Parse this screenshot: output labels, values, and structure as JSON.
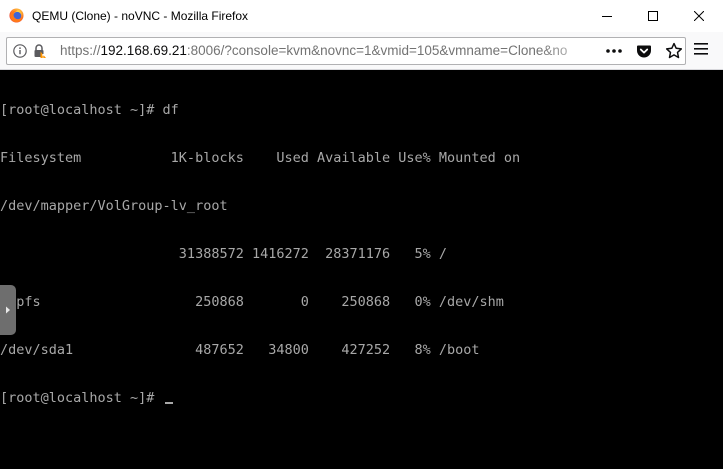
{
  "window": {
    "title": "QEMU (Clone) - noVNC - Mozilla Firefox",
    "controls": [
      "minimize-icon",
      "maximize-icon",
      "close-icon"
    ]
  },
  "navbar": {
    "url_scheme": "https://",
    "url_host": "192.168.69.21",
    "url_rest": ":8006/?console=kvm&novnc=1&vmid=105&vmname=Clone&no",
    "icons": [
      "info-icon",
      "lock-icon",
      "page-actions-icon",
      "pocket-icon",
      "bookmark-star-icon",
      "hamburger-menu-icon"
    ]
  },
  "console": {
    "lines": [
      "[root@localhost ~]# df",
      "Filesystem           1K-blocks    Used Available Use% Mounted on",
      "/dev/mapper/VolGroup-lv_root",
      "                      31388572 1416272  28371176   5% /",
      "tmpfs                   250868       0    250868   0% /dev/shm",
      "/dev/sda1               487652   34800    427252   8% /boot"
    ],
    "prompt": "[root@localhost ~]# ",
    "sidebar_handle_icon": "chevron-right-icon"
  },
  "colors": {
    "terminal_bg": "#000000",
    "terminal_fg": "#a8a8a8",
    "handle_bg": "#6e6e6e",
    "firefox_orange": "#ff9500"
  }
}
